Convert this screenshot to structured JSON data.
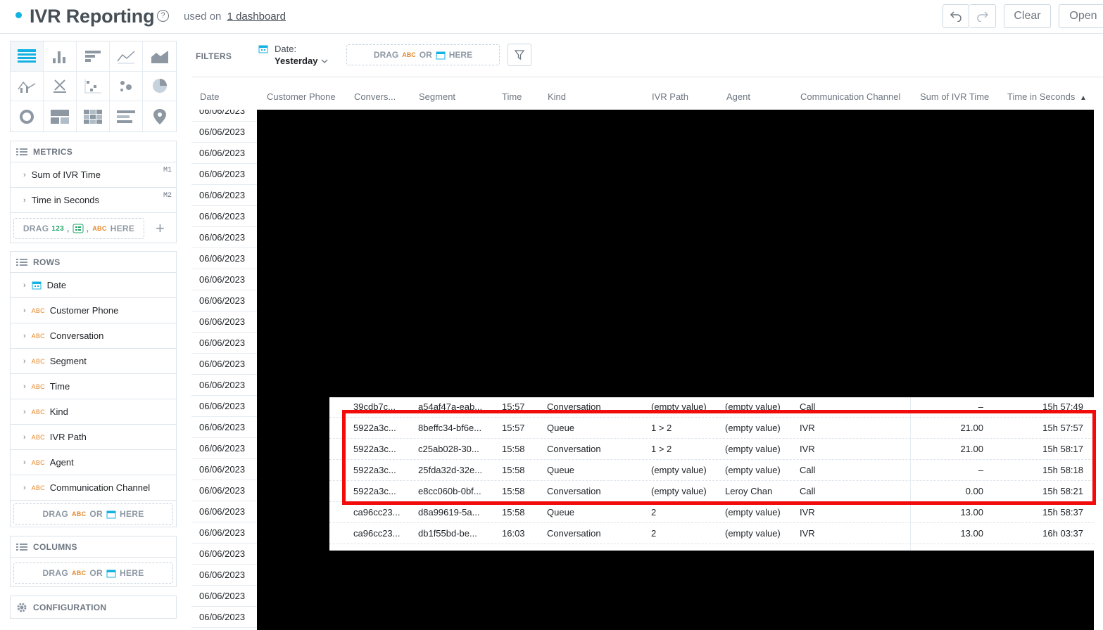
{
  "header": {
    "title": "IVR Reporting",
    "help_glyph": "?",
    "used_on_prefix": "used on",
    "used_on_link": "1 dashboard",
    "clear_label": "Clear",
    "open_label": "Open"
  },
  "metrics": {
    "title": "METRICS",
    "items": [
      {
        "label": "Sum of IVR Time",
        "tag": "M1"
      },
      {
        "label": "Time in Seconds",
        "tag": "M2"
      }
    ],
    "drop": {
      "prefix": "DRAG",
      "num": "123",
      "sep1": ",",
      "sep2": ",",
      "abc": "ABC",
      "suffix": "HERE"
    }
  },
  "rows": {
    "title": "ROWS",
    "items": [
      {
        "type": "date",
        "label": "Date"
      },
      {
        "type": "ABC",
        "label": "Customer Phone"
      },
      {
        "type": "ABC",
        "label": "Conversation"
      },
      {
        "type": "ABC",
        "label": "Segment"
      },
      {
        "type": "ABC",
        "label": "Time"
      },
      {
        "type": "ABC",
        "label": "Kind"
      },
      {
        "type": "ABC",
        "label": "IVR Path"
      },
      {
        "type": "ABC",
        "label": "Agent"
      },
      {
        "type": "ABC",
        "label": "Communication Channel"
      }
    ],
    "drop": {
      "prefix": "DRAG",
      "abc": "ABC",
      "or": "OR",
      "suffix": "HERE"
    }
  },
  "columns": {
    "title": "COLUMNS",
    "drop": {
      "prefix": "DRAG",
      "abc": "ABC",
      "or": "OR",
      "suffix": "HERE"
    }
  },
  "configuration": {
    "title": "CONFIGURATION"
  },
  "filters": {
    "label": "FILTERS",
    "date_label": "Date:",
    "date_value": "Yesterday",
    "drop": {
      "prefix": "DRAG",
      "abc": "ABC",
      "or": "OR",
      "suffix": "HERE"
    }
  },
  "table": {
    "headers": [
      "Date",
      "Customer Phone",
      "Convers...",
      "Segment",
      "Time",
      "Kind",
      "IVR Path",
      "Agent",
      "Communication Channel",
      "Sum of IVR Time",
      "Time in Seconds"
    ],
    "sort_indicator": "▲",
    "dates": [
      "06/06/2023",
      "06/06/2023",
      "06/06/2023",
      "06/06/2023",
      "06/06/2023",
      "06/06/2023",
      "06/06/2023",
      "06/06/2023",
      "06/06/2023",
      "06/06/2023",
      "06/06/2023",
      "06/06/2023",
      "06/06/2023",
      "06/06/2023",
      "06/06/2023",
      "06/06/2023",
      "06/06/2023",
      "06/06/2023",
      "06/06/2023",
      "06/06/2023",
      "06/06/2023",
      "06/06/2023",
      "06/06/2023",
      "06/06/2023",
      "06/06/2023"
    ],
    "rows": [
      {
        "conversation": "39cdb7c...",
        "segment": "a54af47a-eab...",
        "time": "15:57",
        "kind": "Conversation",
        "ivr_path": "(empty value)",
        "agent": "(empty value)",
        "channel": "Call",
        "sum_ivr": "–",
        "seconds": "15h 57:49"
      },
      {
        "conversation": "5922a3c...",
        "segment": "8beffc34-bf6e...",
        "time": "15:57",
        "kind": "Queue",
        "ivr_path": "1 > 2",
        "agent": "(empty value)",
        "channel": "IVR",
        "sum_ivr": "21.00",
        "seconds": "15h 57:57"
      },
      {
        "conversation": "5922a3c...",
        "segment": "c25ab028-30...",
        "time": "15:58",
        "kind": "Conversation",
        "ivr_path": "1 > 2",
        "agent": "(empty value)",
        "channel": "IVR",
        "sum_ivr": "21.00",
        "seconds": "15h 58:17"
      },
      {
        "conversation": "5922a3c...",
        "segment": "25fda32d-32e...",
        "time": "15:58",
        "kind": "Queue",
        "ivr_path": "(empty value)",
        "agent": "(empty value)",
        "channel": "Call",
        "sum_ivr": "–",
        "seconds": "15h 58:18"
      },
      {
        "conversation": "5922a3c...",
        "segment": "e8cc060b-0bf...",
        "time": "15:58",
        "kind": "Conversation",
        "ivr_path": "(empty value)",
        "agent": "Leroy Chan",
        "channel": "Call",
        "sum_ivr": "0.00",
        "seconds": "15h 58:21"
      },
      {
        "conversation": "ca96cc23...",
        "segment": "d8a99619-5a...",
        "time": "15:58",
        "kind": "Queue",
        "ivr_path": "2",
        "agent": "(empty value)",
        "channel": "IVR",
        "sum_ivr": "13.00",
        "seconds": "15h 58:37"
      },
      {
        "conversation": "ca96cc23...",
        "segment": "db1f55bd-be...",
        "time": "16:03",
        "kind": "Conversation",
        "ivr_path": "2",
        "agent": "(empty value)",
        "channel": "IVR",
        "sum_ivr": "13.00",
        "seconds": "16h 03:37"
      }
    ]
  },
  "colors": {
    "accent": "#14b2e2",
    "highlight": "#f20b0b",
    "abc": "#e5872a",
    "numeric": "#25a56a"
  }
}
